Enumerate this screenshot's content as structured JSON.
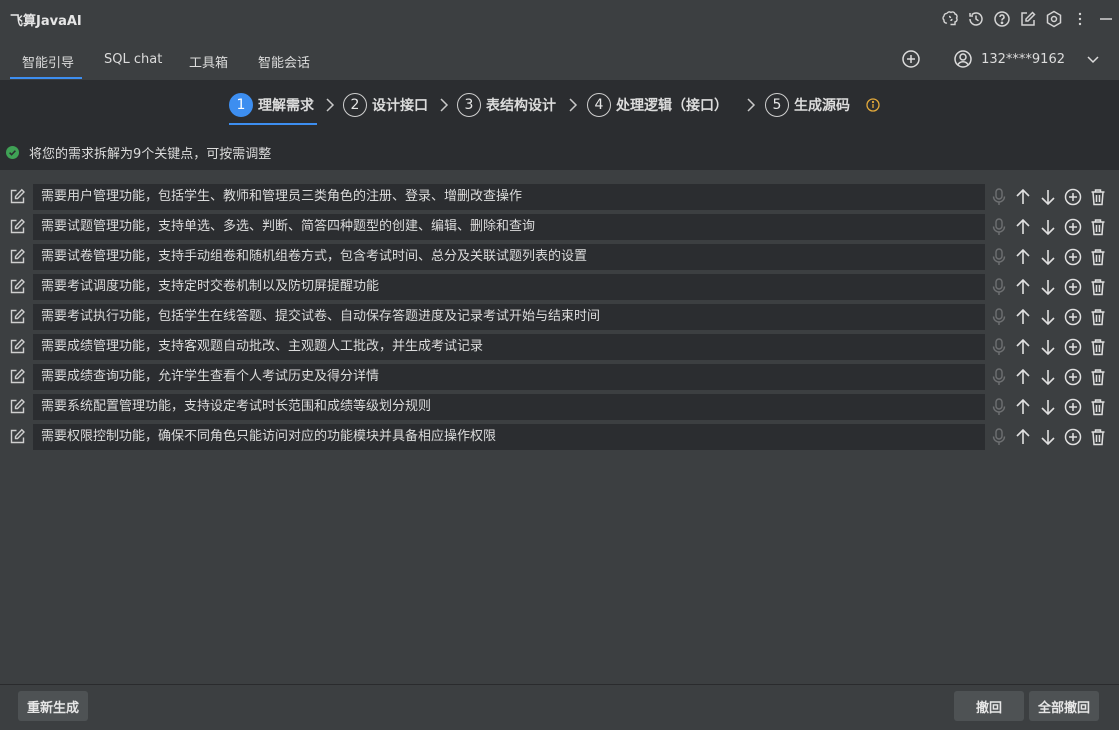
{
  "app": {
    "title": "飞算JavaAI"
  },
  "title_icons": [
    "brain-icon",
    "history-icon",
    "help-icon",
    "edit-icon",
    "settings-icon",
    "more-icon",
    "minimize-icon"
  ],
  "nav": {
    "tabs": [
      {
        "label": "智能引导",
        "active": true
      },
      {
        "label": "SQL chat",
        "active": false
      },
      {
        "label": "工具箱",
        "active": false
      },
      {
        "label": "智能会话",
        "active": false
      }
    ],
    "user": "132****9162"
  },
  "steps": [
    {
      "num": "1",
      "label": "理解需求",
      "active": true
    },
    {
      "num": "2",
      "label": "设计接口",
      "active": false
    },
    {
      "num": "3",
      "label": "表结构设计",
      "active": false
    },
    {
      "num": "4",
      "label": "处理逻辑（接口）",
      "active": false
    },
    {
      "num": "5",
      "label": "生成源码",
      "active": false
    }
  ],
  "summary": "将您的需求拆解为9个关键点，可按需调整",
  "requirements": [
    "需要用户管理功能，包括学生、教师和管理员三类角色的注册、登录、增删改查操作",
    "需要试题管理功能，支持单选、多选、判断、简答四种题型的创建、编辑、删除和查询",
    "需要试卷管理功能，支持手动组卷和随机组卷方式，包含考试时间、总分及关联试题列表的设置",
    "需要考试调度功能，支持定时交卷机制以及防切屏提醒功能",
    "需要考试执行功能，包括学生在线答题、提交试卷、自动保存答题进度及记录考试开始与结束时间",
    "需要成绩管理功能，支持客观题自动批改、主观题人工批改，并生成考试记录",
    "需要成绩查询功能，允许学生查看个人考试历史及得分详情",
    "需要系统配置管理功能，支持设定考试时长范围和成绩等级划分规则",
    "需要权限控制功能，确保不同角色只能访问对应的功能模块并具备相应操作权限"
  ],
  "footer": {
    "regenerate": "重新生成",
    "undo": "撤回",
    "undo_all": "全部撤回"
  },
  "colors": {
    "accent": "#3d8ef0",
    "success": "#3fa155",
    "warning": "#e2a93b"
  }
}
